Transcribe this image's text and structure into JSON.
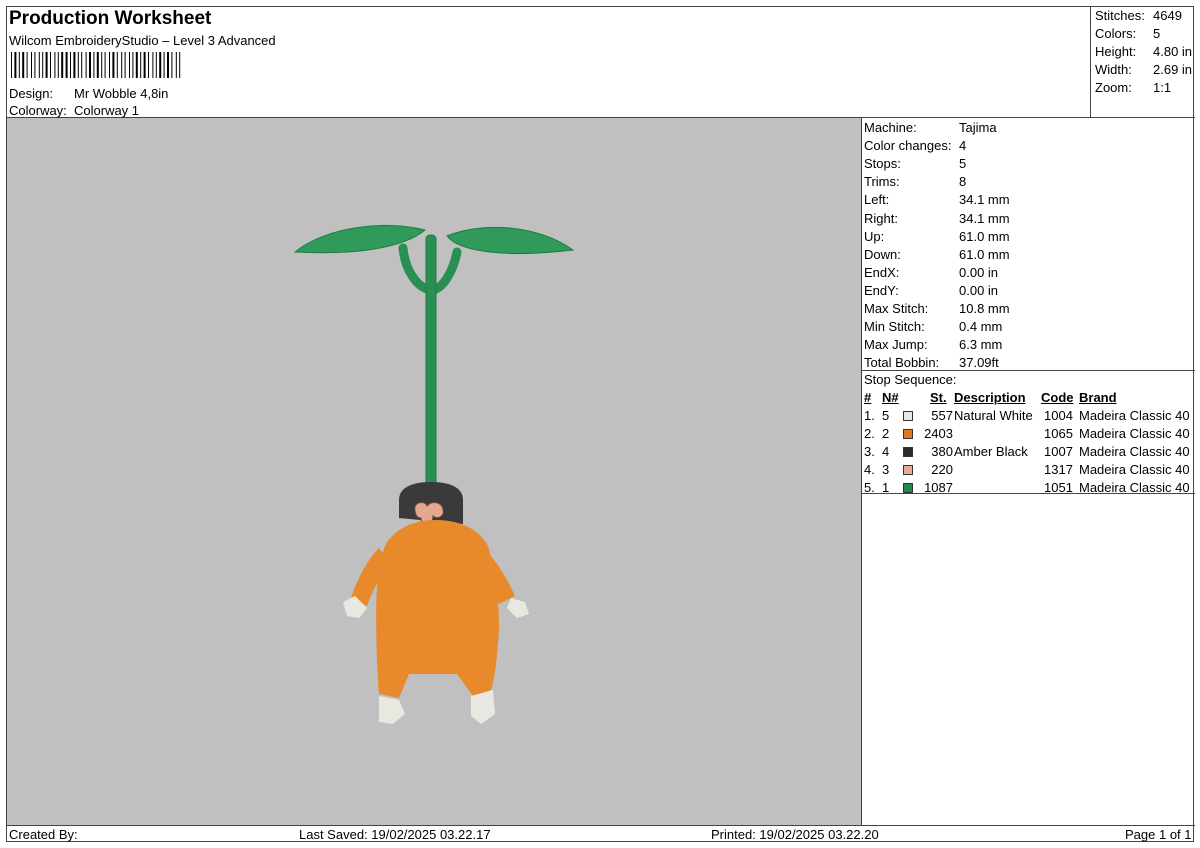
{
  "header": {
    "title": "Production Worksheet",
    "software": "Wilcom EmbroideryStudio – Level 3 Advanced",
    "design_label": "Design:",
    "design_value": "Mr Wobble 4,8in",
    "colorway_label": "Colorway:",
    "colorway_value": "Colorway 1"
  },
  "summary": {
    "stitches_label": "Stitches:",
    "stitches": "4649",
    "colors_label": "Colors:",
    "colors": "5",
    "height_label": "Height:",
    "height": "4.80 in",
    "width_label": "Width:",
    "width": "2.69 in",
    "zoom_label": "Zoom:",
    "zoom": "1:1"
  },
  "properties": [
    {
      "label": "Machine:",
      "value": "Tajima"
    },
    {
      "label": "Color changes:",
      "value": "4"
    },
    {
      "label": "Stops:",
      "value": "5"
    },
    {
      "label": "Trims:",
      "value": "8"
    },
    {
      "label": "Left:",
      "value": "34.1 mm"
    },
    {
      "label": "Right:",
      "value": "34.1 mm"
    },
    {
      "label": "Up:",
      "value": "61.0 mm"
    },
    {
      "label": "Down:",
      "value": "61.0 mm"
    },
    {
      "label": "EndX:",
      "value": "0.00 in"
    },
    {
      "label": "EndY:",
      "value": "0.00 in"
    },
    {
      "label": "Max Stitch:",
      "value": "10.8 mm"
    },
    {
      "label": "Min Stitch:",
      "value": "0.4 mm"
    },
    {
      "label": "Max Jump:",
      "value": "6.3 mm"
    },
    {
      "label": "Total Bobbin:",
      "value": "37.09ft"
    }
  ],
  "stop_sequence": {
    "title": "Stop Sequence:",
    "headers": {
      "num": "#",
      "n": "N#",
      "st": "St.",
      "desc": "Description",
      "code": "Code",
      "brand": "Brand"
    },
    "rows": [
      {
        "num": "1.",
        "n": "5",
        "color": "#e6e6e6",
        "st": "557",
        "desc": "Natural White",
        "code": "1004",
        "brand": "Madeira Classic 40"
      },
      {
        "num": "2.",
        "n": "2",
        "color": "#e07a1f",
        "st": "2403",
        "desc": "",
        "code": "1065",
        "brand": "Madeira Classic 40"
      },
      {
        "num": "3.",
        "n": "4",
        "color": "#2b2b2b",
        "st": "380",
        "desc": "Amber Black",
        "code": "1007",
        "brand": "Madeira Classic 40"
      },
      {
        "num": "4.",
        "n": "3",
        "color": "#e8a89a",
        "st": "220",
        "desc": "",
        "code": "1317",
        "brand": "Madeira Classic 40"
      },
      {
        "num": "5.",
        "n": "1",
        "color": "#1f8a4c",
        "st": "1087",
        "desc": "",
        "code": "1051",
        "brand": "Madeira Classic 40"
      }
    ]
  },
  "footer": {
    "created_by": "Created By:",
    "last_saved": "Last Saved: 19/02/2025 03.22.17",
    "printed": "Printed: 19/02/2025 03.22.20",
    "page": "Page 1 of 1"
  },
  "colors": {
    "preview_bg": "#c0c0c0",
    "leaf": "#2f9a5a",
    "stem": "#2a8f52",
    "body": "#e8892c",
    "head": "#3a3a3a",
    "face": "#e3a890",
    "feet": "#e8e8e0"
  }
}
